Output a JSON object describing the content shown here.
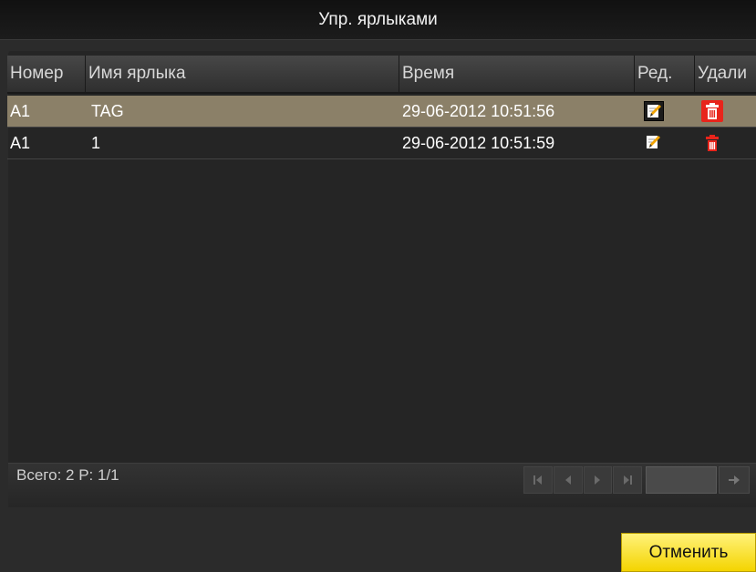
{
  "window": {
    "title": "Упр. ярлыками"
  },
  "table": {
    "columns": [
      "Номер",
      "Имя ярлыка",
      "Время",
      "Ред.",
      "Удали"
    ],
    "rows": [
      {
        "num": "A1",
        "name": "TAG",
        "time": "29-06-2012 10:51:56",
        "selected": true
      },
      {
        "num": "A1",
        "name": "1",
        "time": "29-06-2012 10:51:59",
        "selected": false
      }
    ]
  },
  "footer": {
    "total": "Всего: 2 P: 1/1",
    "page_input_value": ""
  },
  "icons": {
    "edit": "edit-pencil-icon",
    "delete": "trash-icon",
    "first": "first-page-icon",
    "prev": "prev-page-icon",
    "next": "next-page-icon",
    "last": "last-page-icon",
    "go": "arrow-right-icon"
  },
  "colors": {
    "selected_row": "#8b8068",
    "delete_button": "#e8241b",
    "cancel_button": "#f4d400"
  },
  "buttons": {
    "cancel": "Отменить"
  }
}
